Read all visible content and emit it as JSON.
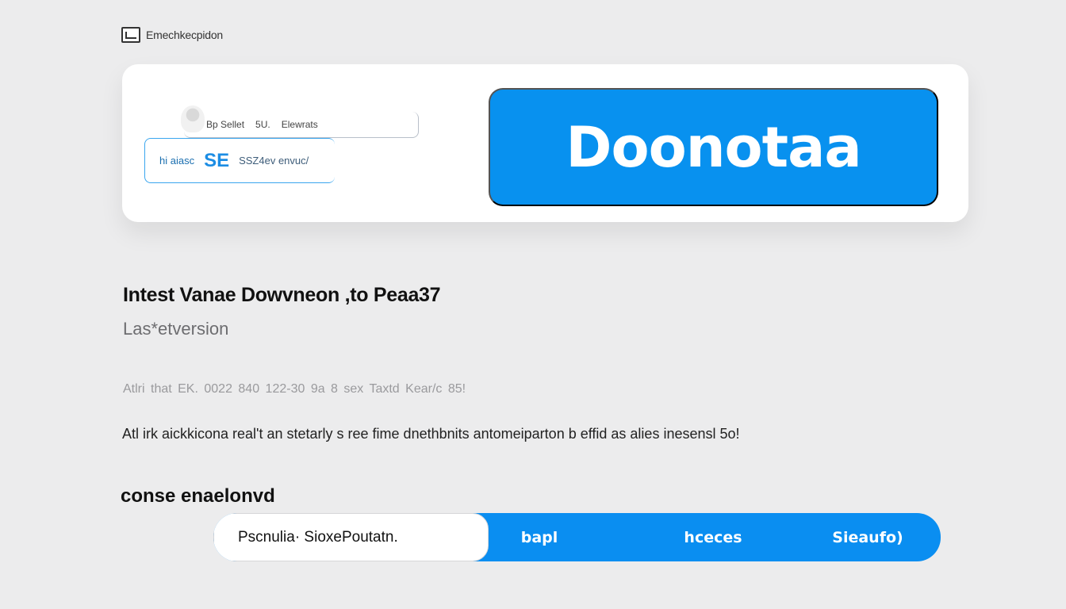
{
  "brand": {
    "icon": "chart-icon",
    "label": "Emechkecpidon"
  },
  "hero": {
    "top_row": [
      "Bp Sellet",
      "5U.",
      "Elewrats"
    ],
    "field": {
      "tag": "hi aiasc",
      "glyph": "SE",
      "text": "SSZ4ev envuc/"
    },
    "cta_label": "Doonotaa"
  },
  "content": {
    "heading": "Intest Vanae Dowvneon ,to Peaa37",
    "subheading": "Las*etversion",
    "meta": "Atlri that EK. 0022 840 122-30 9a 8 sex Taxtd Kear/c 85!",
    "description": "Atl irk aickkicona real't an stetarly s ree fime dnethbnits antomeiparton b effid as alies inesensl 5o!",
    "section_title": "conse enaelonvd"
  },
  "bar": {
    "input_value": "Pscnulia· SioxePoutatn.",
    "buttons": [
      "bapl",
      "hceces",
      "Sieaufo)"
    ]
  },
  "colors": {
    "accent": "#0a8ef1",
    "background": "#ececed"
  }
}
